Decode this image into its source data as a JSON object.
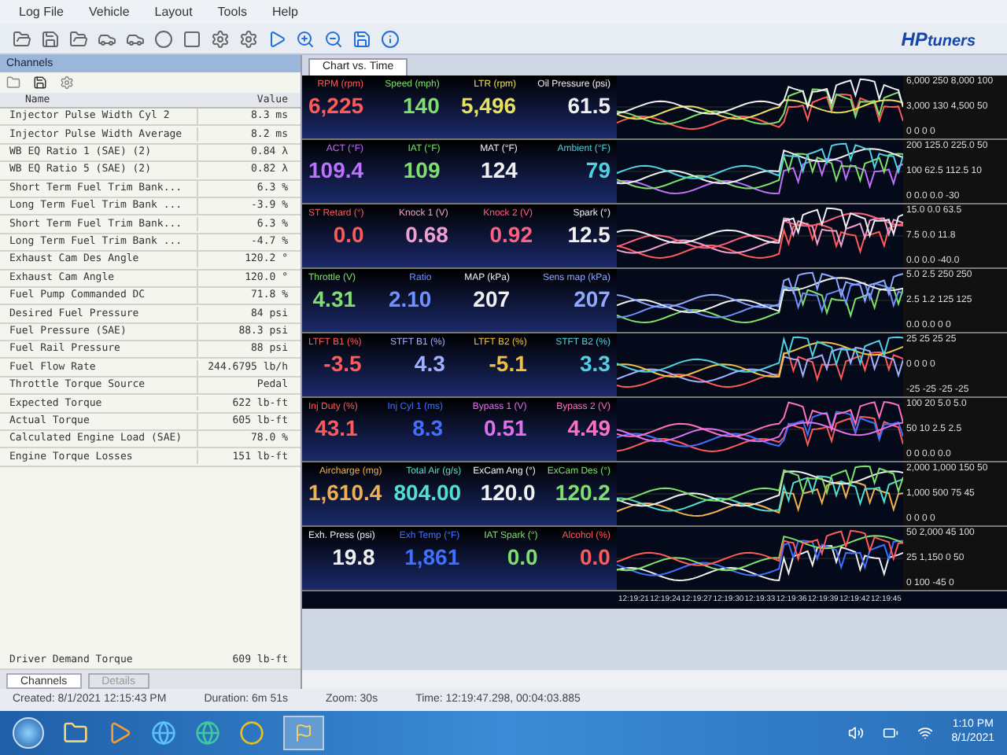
{
  "menu": [
    "Log File",
    "Vehicle",
    "Layout",
    "Tools",
    "Help"
  ],
  "logo": {
    "text": "HP",
    "subtext": "tuners"
  },
  "channels_panel": {
    "title": "Channels",
    "columns": [
      "Name",
      "Value"
    ],
    "rows": [
      {
        "name": "Injector Pulse Width Cyl 2",
        "value": "8.3 ms"
      },
      {
        "name": "Injector Pulse Width Average",
        "value": "8.2 ms"
      },
      {
        "name": "WB EQ Ratio 1 (SAE) (2)",
        "value": "0.84 λ"
      },
      {
        "name": "WB EQ Ratio 5 (SAE) (2)",
        "value": "0.82 λ"
      },
      {
        "name": "Short Term Fuel Trim Bank...",
        "value": "6.3 %"
      },
      {
        "name": "Long Term Fuel Trim Bank ...",
        "value": "-3.9 %"
      },
      {
        "name": "Short Term Fuel Trim Bank...",
        "value": "6.3 %"
      },
      {
        "name": "Long Term Fuel Trim Bank ...",
        "value": "-4.7 %"
      },
      {
        "name": "Exhaust Cam Des Angle",
        "value": "120.2 °"
      },
      {
        "name": "Exhaust Cam Angle",
        "value": "120.0 °"
      },
      {
        "name": "Fuel Pump Commanded DC",
        "value": "71.8 %"
      },
      {
        "name": "Desired Fuel Pressure",
        "value": "84 psi"
      },
      {
        "name": "Fuel Pressure (SAE)",
        "value": "88.3 psi"
      },
      {
        "name": "Fuel Rail Pressure",
        "value": "88 psi"
      },
      {
        "name": "Fuel Flow Rate",
        "value": "244.6795 lb/h"
      },
      {
        "name": "Throttle Torque Source",
        "value": "Pedal"
      },
      {
        "name": "Expected Torque",
        "value": "622 lb-ft"
      },
      {
        "name": "Actual Torque",
        "value": "605 lb-ft"
      },
      {
        "name": "Calculated Engine Load (SAE)",
        "value": "78.0 %"
      },
      {
        "name": "Engine Torque Losses",
        "value": "151 lb-ft"
      }
    ],
    "last_row": {
      "name": "Driver Demand Torque",
      "value": "609 lb-ft"
    },
    "tabs": [
      {
        "label": "Channels",
        "selected": true
      },
      {
        "label": "Details",
        "selected": false
      }
    ]
  },
  "chart_tab": {
    "label": "Chart vs. Time",
    "selected": true
  },
  "strips": [
    {
      "gauges": [
        {
          "label": "RPM (rpm)",
          "value": "6,225",
          "color": "#ff5a5a"
        },
        {
          "label": "Speed (mph)",
          "value": "140",
          "color": "#7ee06a"
        },
        {
          "label": "LTR (rpm)",
          "value": "5,496",
          "color": "#e8e060"
        },
        {
          "label": "Oil Pressure (psi)",
          "value": "61.5",
          "color": "#f0f0f0"
        }
      ],
      "scale": [
        "6,000 250 8,000 100",
        "3,000 130 4,500 50",
        "0 0 0 0"
      ]
    },
    {
      "gauges": [
        {
          "label": "ACT (°F)",
          "value": "109.4",
          "color": "#c070ff"
        },
        {
          "label": "IAT (°F)",
          "value": "109",
          "color": "#7ee06a"
        },
        {
          "label": "MAT (°F)",
          "value": "124",
          "color": "#f0f0f0"
        },
        {
          "label": "Ambient (°F)",
          "value": "79",
          "color": "#50d0e0"
        }
      ],
      "scale": [
        "200 125.0 225.0 50",
        "100 62.5 112.5 10",
        "0 0.0 0.0 -30"
      ]
    },
    {
      "gauges": [
        {
          "label": "ST Retard (°)",
          "value": "0.0",
          "color": "#ff5a5a"
        },
        {
          "label": "Knock 1 (V)",
          "value": "0.68",
          "color": "#f0a0d0"
        },
        {
          "label": "Knock 2 (V)",
          "value": "0.92",
          "color": "#ff6080"
        },
        {
          "label": "Spark (°)",
          "value": "12.5",
          "color": "#f0f0f0"
        }
      ],
      "scale": [
        "15.0 0.0 63.5",
        "7.5 0.0 11.8",
        "0.0 0.0 -40.0"
      ]
    },
    {
      "gauges": [
        {
          "label": "Throttle (V)",
          "value": "4.31",
          "color": "#7ee06a"
        },
        {
          "label": "Ratio",
          "value": "2.10",
          "color": "#7090ff"
        },
        {
          "label": "MAP (kPa)",
          "value": "207",
          "color": "#f0f0f0"
        },
        {
          "label": "Sens map (kPa)",
          "value": "207",
          "color": "#90a8ff"
        }
      ],
      "scale": [
        "5.0 2.5 250 250",
        "2.5 1.2 125 125",
        "0.0 0.0 0 0"
      ]
    },
    {
      "gauges": [
        {
          "label": "LTFT B1 (%)",
          "value": "-3.5",
          "color": "#ff5a5a"
        },
        {
          "label": "STFT B1 (%)",
          "value": "4.3",
          "color": "#a0b0ff"
        },
        {
          "label": "LTFT B2 (%)",
          "value": "-5.1",
          "color": "#f0c040"
        },
        {
          "label": "STFT B2 (%)",
          "value": "3.3",
          "color": "#50d0e0"
        }
      ],
      "scale": [
        "25 25 25 25",
        "0 0 0 0",
        "-25 -25 -25 -25"
      ]
    },
    {
      "gauges": [
        {
          "label": "Inj Duty (%)",
          "value": "43.1",
          "color": "#ff5a5a"
        },
        {
          "label": "Inj Cyl 1 (ms)",
          "value": "8.3",
          "color": "#4070ff"
        },
        {
          "label": "Bypass 1 (V)",
          "value": "0.51",
          "color": "#e070f0"
        },
        {
          "label": "Bypass 2 (V)",
          "value": "4.49",
          "color": "#ff70c0"
        }
      ],
      "scale": [
        "100 20 5.0 5.0",
        "50 10 2.5 2.5",
        "0 0 0.0 0.0"
      ]
    },
    {
      "gauges": [
        {
          "label": "Aircharge (mg)",
          "value": "1,610.4",
          "color": "#f0b050"
        },
        {
          "label": "Total Air (g/s)",
          "value": "804.00",
          "color": "#50e0d0"
        },
        {
          "label": "ExCam Ang (°)",
          "value": "120.0",
          "color": "#f0f0f0"
        },
        {
          "label": "ExCam Des (°)",
          "value": "120.2",
          "color": "#7ee06a"
        }
      ],
      "scale": [
        "2,000 1,000 150 50",
        "1,000 500 75 45",
        "0 0 0 0"
      ]
    },
    {
      "gauges": [
        {
          "label": "Exh. Press (psi)",
          "value": "19.8",
          "color": "#f0f0f0"
        },
        {
          "label": "Exh Temp (°F)",
          "value": "1,861",
          "color": "#4070ff"
        },
        {
          "label": "IAT Spark (°)",
          "value": "0.0",
          "color": "#7ee06a"
        },
        {
          "label": "Alcohol (%)",
          "value": "0.0",
          "color": "#ff5a5a"
        }
      ],
      "scale": [
        "50 2,000 45 100",
        "25 1,150 0 50",
        "0 100 -45 0"
      ]
    }
  ],
  "time_axis": [
    "12:19:21",
    "12:19:24",
    "12:19:27",
    "12:19:30",
    "12:19:33",
    "12:19:36",
    "12:19:39",
    "12:19:42",
    "12:19:45"
  ],
  "status_bar": [
    "Created: 8/1/2021 12:15:43 PM",
    "Duration: 6m 51s",
    "Zoom: 30s",
    "Time: 12:19:47.298, 00:04:03.885"
  ],
  "taskbar": {
    "time": "1:10 PM",
    "date": "8/1/2021"
  }
}
